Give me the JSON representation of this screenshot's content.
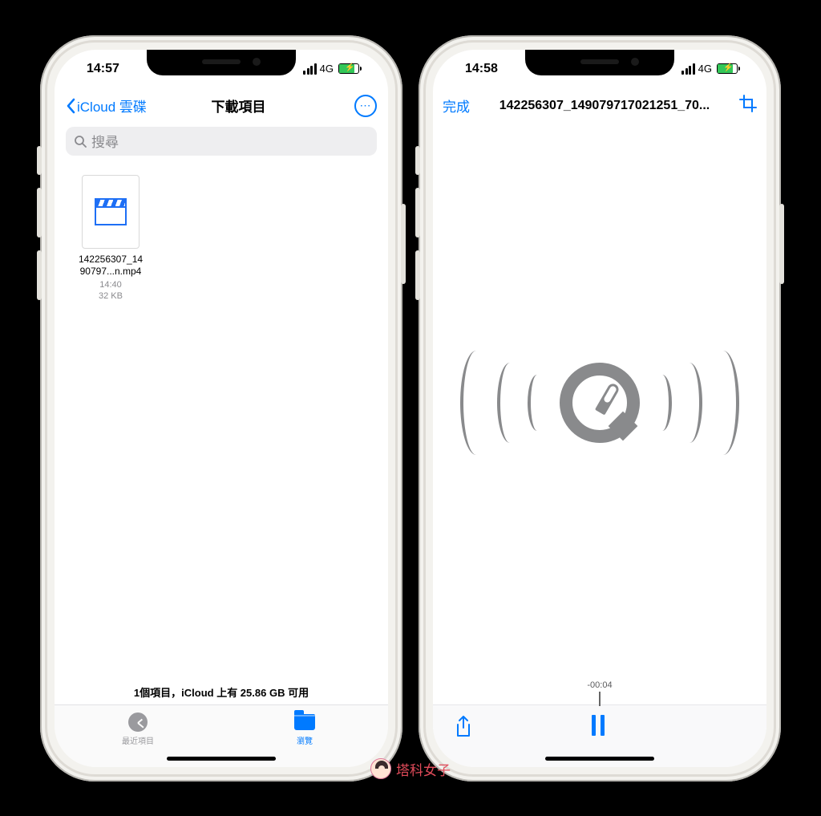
{
  "left": {
    "status": {
      "time": "14:57",
      "network": "4G"
    },
    "nav": {
      "back_label": "iCloud 雲碟",
      "title": "下載項目"
    },
    "search": {
      "placeholder": "搜尋"
    },
    "file": {
      "name_line1": "142256307_14",
      "name_line2": "90797...n.mp4",
      "time": "14:40",
      "size": "32 KB"
    },
    "footer": "1個項目，iCloud 上有 25.86 GB 可用",
    "tabs": {
      "recent": "最近項目",
      "browse": "瀏覽"
    }
  },
  "right": {
    "status": {
      "time": "14:58",
      "network": "4G"
    },
    "nav": {
      "done": "完成",
      "filename": "142256307_149079717021251_70..."
    },
    "time_remaining": "-00:04"
  },
  "watermark": "塔科女子"
}
